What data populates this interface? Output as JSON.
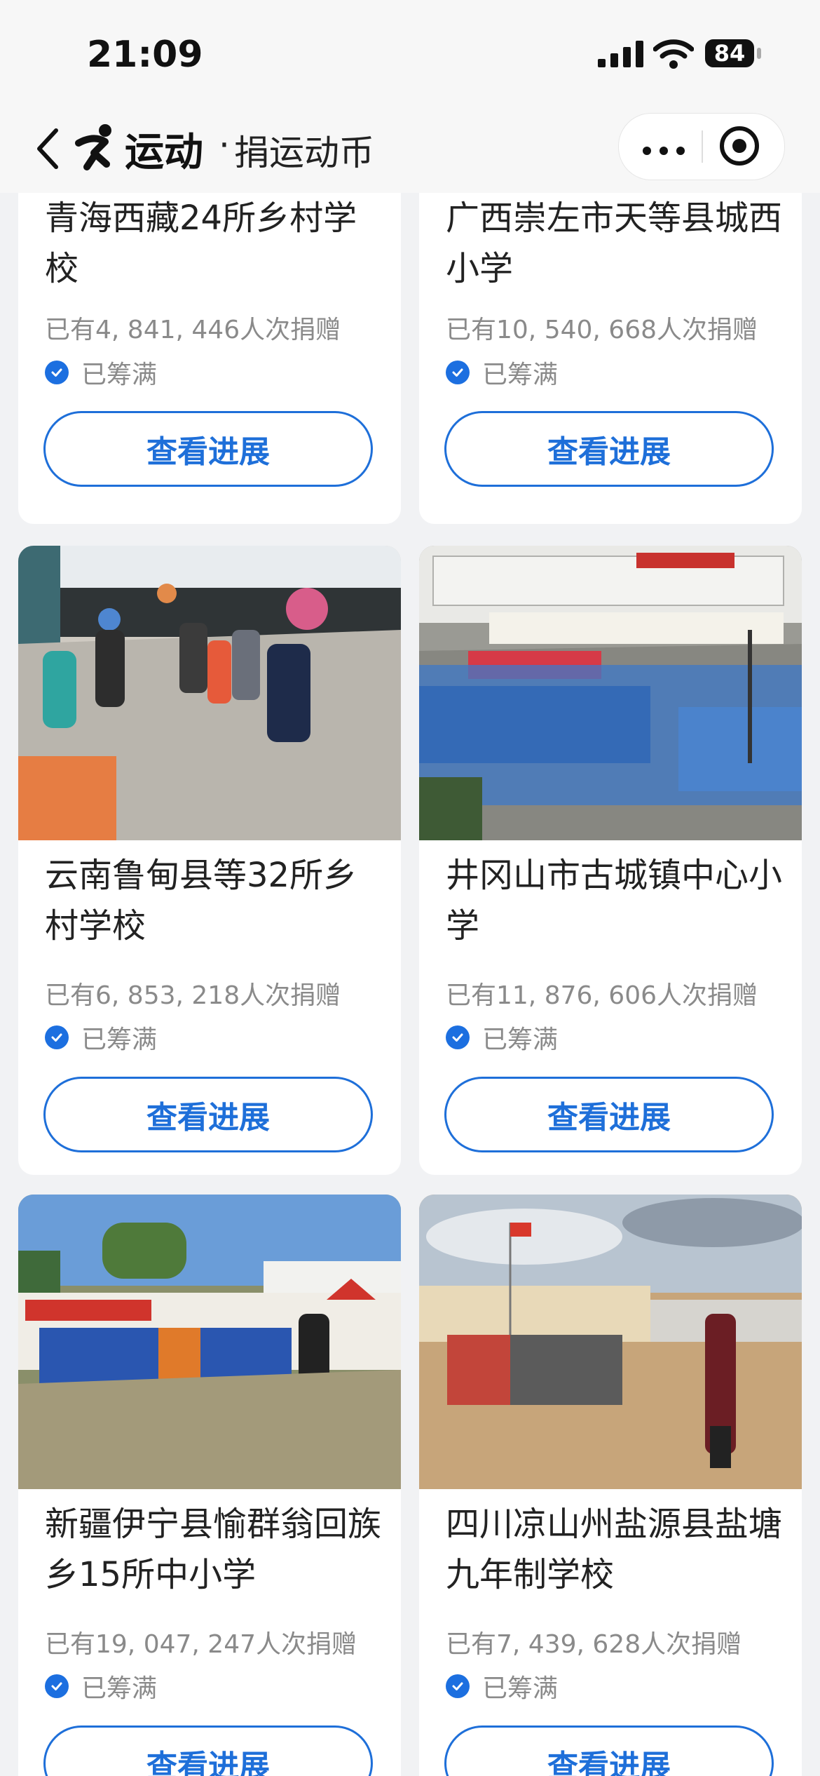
{
  "status_bar": {
    "time": "21:09",
    "battery": "84"
  },
  "nav": {
    "brand": "运动",
    "separator": "·",
    "subtitle": "捐运动币"
  },
  "cards": [
    {
      "title": "青海西藏24所乡村学校",
      "donors": "已有4, 841, 446人次捐赠",
      "status": "已筹满",
      "button": "查看进展"
    },
    {
      "title": "广西崇左市天等县城西小学",
      "donors": "已有10, 540, 668人次捐赠",
      "status": "已筹满",
      "button": "查看进展"
    },
    {
      "title": "云南鲁甸县等32所乡村学校",
      "donors": "已有6, 853, 218人次捐赠",
      "status": "已筹满",
      "button": "查看进展"
    },
    {
      "title": "井冈山市古城镇中心小学",
      "donors": "已有11, 876, 606人次捐赠",
      "status": "已筹满",
      "button": "查看进展"
    },
    {
      "title": "新疆伊宁县愉群翁回族乡15所中小学",
      "donors": "已有19, 047, 247人次捐赠",
      "status": "已筹满",
      "button": "查看进展"
    },
    {
      "title": "四川凉山州盐源县盐塘九年制学校",
      "donors": "已有7, 439, 628人次捐赠",
      "status": "已筹满",
      "button": "查看进展"
    }
  ],
  "icons": {
    "back": "chevron-left-icon",
    "logo": "runner-logo-icon",
    "more": "more-dots-icon",
    "close": "target-close-icon",
    "verified": "check-circle-icon"
  },
  "colors": {
    "accent": "#1e6fd9",
    "background": "#f1f2f4"
  }
}
